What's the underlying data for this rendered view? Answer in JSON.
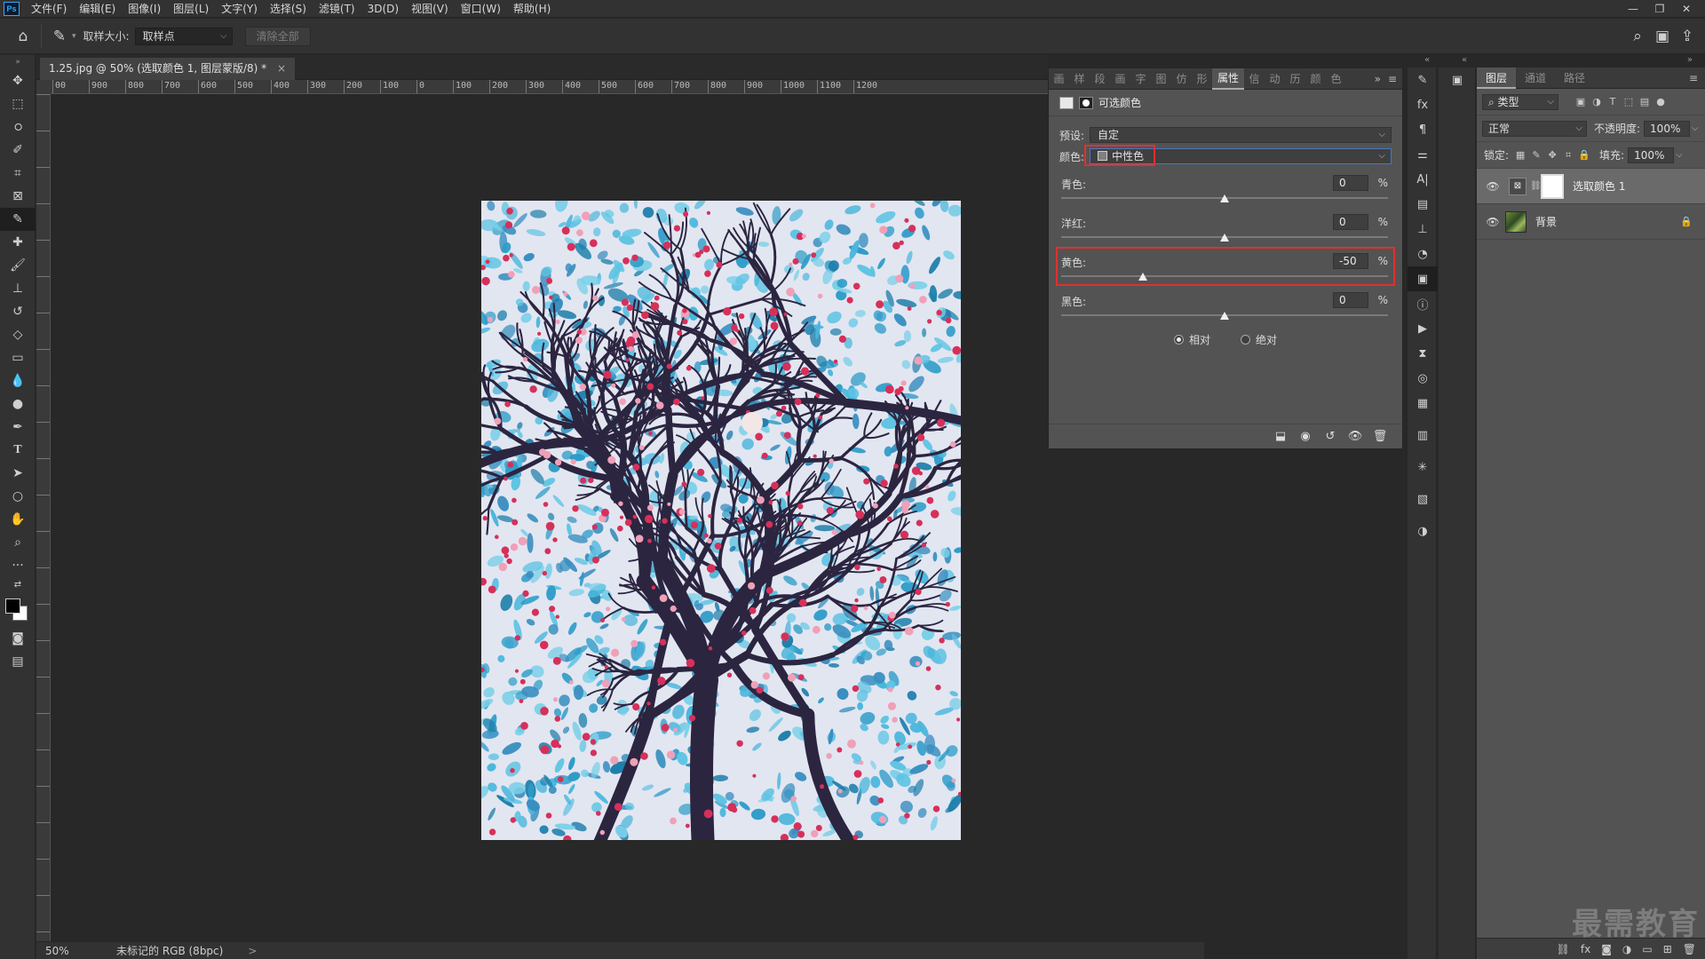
{
  "app": {
    "logo": "Ps"
  },
  "menu": [
    "文件(F)",
    "编辑(E)",
    "图像(I)",
    "图层(L)",
    "文字(Y)",
    "选择(S)",
    "滤镜(T)",
    "3D(D)",
    "视图(V)",
    "窗口(W)",
    "帮助(H)"
  ],
  "options": {
    "sample_size_label": "取样大小:",
    "sample_size_value": "取样点",
    "clear_all": "清除全部"
  },
  "document": {
    "tab_title": "1.25.jpg @ 50% (选取颜色 1, 图层蒙版/8) *",
    "close": "×"
  },
  "ruler": {
    "h_ticks": [
      "00",
      "900",
      "800",
      "700",
      "600",
      "500",
      "400",
      "300",
      "200",
      "100",
      "0",
      "100",
      "200",
      "300",
      "400",
      "500",
      "600",
      "700",
      "800",
      "900",
      "1000",
      "1100",
      "1200"
    ]
  },
  "status": {
    "zoom": "50%",
    "info": "未标记的 RGB (8bpc)",
    "arrow": ">"
  },
  "properties": {
    "tabs": [
      "画",
      "样",
      "段",
      "画",
      "字",
      "图",
      "仿",
      "形",
      "属性",
      "信",
      "动",
      "历",
      "颜",
      "色"
    ],
    "active_tab": "属性",
    "title": "可选颜色",
    "preset_label": "预设:",
    "preset_value": "自定",
    "color_label": "颜色:",
    "color_value": "中性色",
    "sliders": [
      {
        "label": "青色:",
        "value": "0",
        "pct": "%",
        "level": 0
      },
      {
        "label": "洋红:",
        "value": "0",
        "pct": "%",
        "level": 0
      },
      {
        "label": "黄色:",
        "value": "-50",
        "pct": "%",
        "level": -50
      },
      {
        "label": "黑色:",
        "value": "0",
        "pct": "%",
        "level": 0
      }
    ],
    "method_relative": "相对",
    "method_absolute": "绝对",
    "method_selected": "相对"
  },
  "layers": {
    "tabs": [
      "图层",
      "通道",
      "路径"
    ],
    "active_tab": "图层",
    "filter_value": "类型",
    "blend_mode": "正常",
    "opacity_label": "不透明度:",
    "opacity_value": "100%",
    "lock_label": "锁定:",
    "fill_label": "填充:",
    "fill_value": "100%",
    "items": [
      {
        "name": "选取颜色 1",
        "selected": true
      },
      {
        "name": "背景",
        "selected": false
      }
    ]
  },
  "watermark": "最需教育",
  "colors": {
    "accent_red": "#e03030",
    "panel": "#535353",
    "bg": "#282828"
  }
}
